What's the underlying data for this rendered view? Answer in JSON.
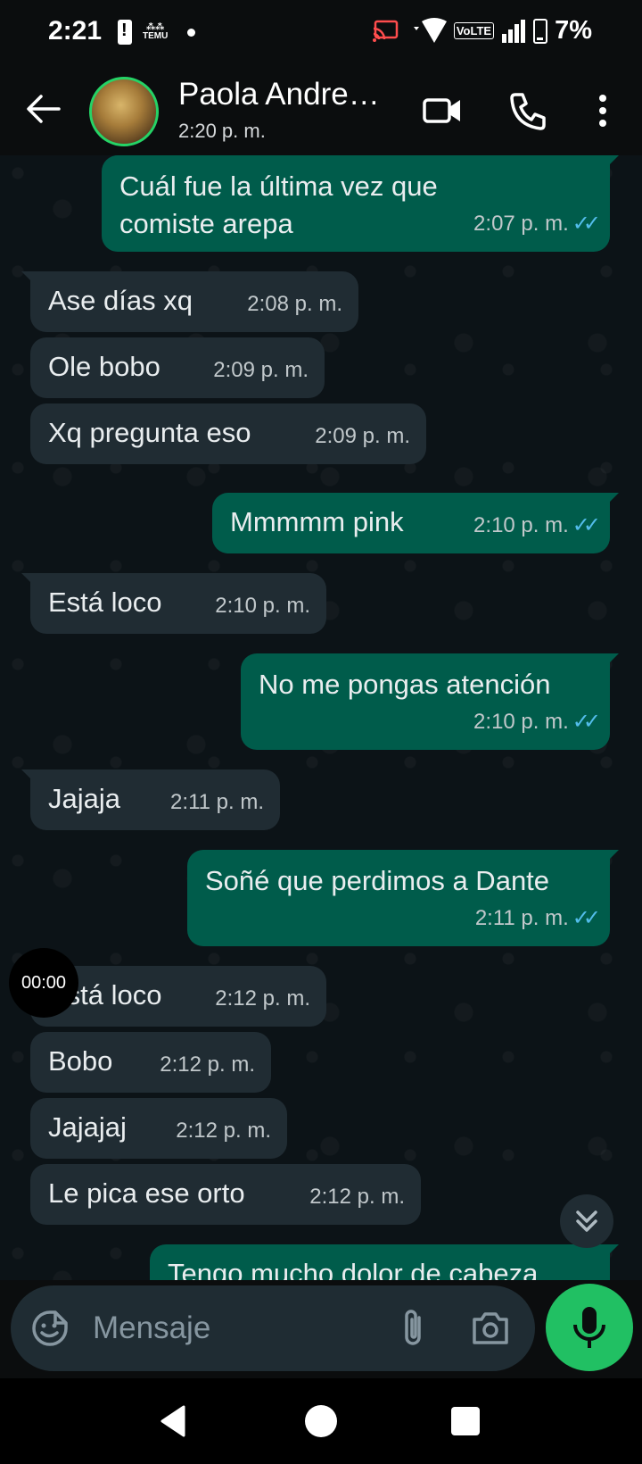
{
  "status_bar": {
    "time": "2:21",
    "temu_label": "TEMU",
    "volte": "VoLTE",
    "battery": "7%"
  },
  "header": {
    "contact_name": "Paola Andre…",
    "last_seen": "2:20 p. m."
  },
  "messages": [
    {
      "dir": "out",
      "text": "Cuál fue la última vez que comiste arepa",
      "time": "2:07 p. m.",
      "read": true
    },
    {
      "dir": "in",
      "text": "Ase días xq",
      "time": "2:08 p. m."
    },
    {
      "dir": "in",
      "text": "Ole bobo",
      "time": "2:09 p. m."
    },
    {
      "dir": "in",
      "text": "Xq pregunta eso",
      "time": "2:09 p. m."
    },
    {
      "dir": "out",
      "text": "Mmmmm pink",
      "time": "2:10 p. m.",
      "read": true
    },
    {
      "dir": "in",
      "text": "Está loco",
      "time": "2:10 p. m."
    },
    {
      "dir": "out",
      "text": "No me pongas atención",
      "time": "2:10 p. m.",
      "read": true
    },
    {
      "dir": "in",
      "text": "Jajaja",
      "time": "2:11 p. m."
    },
    {
      "dir": "out",
      "text": "Soñé que perdimos a Dante",
      "time": "2:11 p. m.",
      "read": true
    },
    {
      "dir": "in",
      "text": "Está loco",
      "time": "2:12 p. m."
    },
    {
      "dir": "in",
      "text": "Bobo",
      "time": "2:12 p. m."
    },
    {
      "dir": "in",
      "text": "Jajajaj",
      "time": "2:12 p. m."
    },
    {
      "dir": "in",
      "text": "Le pica ese orto",
      "time": "2:12 p. m."
    },
    {
      "dir": "out",
      "text": "Tengo mucho dolor de cabeza",
      "time": "",
      "read": true
    }
  ],
  "recorder_time": "00:00",
  "composer": {
    "placeholder": "Mensaje"
  },
  "colors": {
    "incoming_bubble": "#202c33",
    "outgoing_bubble": "#005c4b",
    "read_ticks": "#53bdeb",
    "accent": "#21c063"
  }
}
